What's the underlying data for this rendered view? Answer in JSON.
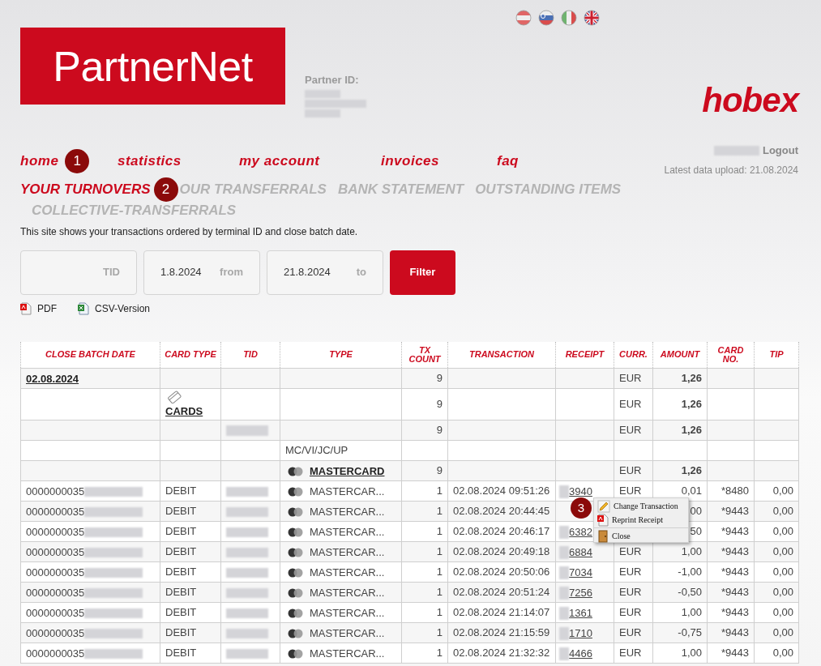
{
  "header": {
    "logo": "PartnerNet",
    "partner_id_label": "Partner ID:",
    "brand": "hobex",
    "logout": "Logout",
    "latest_upload": "Latest data upload: 21.08.2024"
  },
  "nav": [
    {
      "label": "home",
      "badge": "1"
    },
    {
      "label": "statistics"
    },
    {
      "label": "my account"
    },
    {
      "label": "invoices"
    },
    {
      "label": "faq"
    }
  ],
  "tabs": [
    {
      "label": "YOUR TURNOVERS",
      "selected": true,
      "badge": "2"
    },
    {
      "label": "OUR TRANSFERRALS",
      "selected": false
    },
    {
      "label": "BANK STATEMENT",
      "selected": false
    },
    {
      "label": "OUTSTANDING ITEMS",
      "selected": false
    },
    {
      "label": "COLLECTIVE-TRANSFERRALS",
      "selected": false
    }
  ],
  "intro": "This site shows your transactions ordered by terminal ID and close batch date.",
  "filter": {
    "fields": [
      {
        "label": "TID"
      },
      {
        "value": "1.8.2024",
        "label": "from"
      },
      {
        "value": "21.8.2024",
        "label": "to"
      }
    ],
    "button": "Filter"
  },
  "exports": [
    {
      "label": "PDF",
      "kind": "pdf"
    },
    {
      "label": "CSV-Version",
      "kind": "csv"
    }
  ],
  "table": {
    "columns": [
      "CLOSE BATCH DATE",
      "CARD TYPE",
      "TID",
      "TYPE",
      "TX COUNT",
      "TRANSACTION",
      "RECEIPT",
      "CURR.",
      "AMOUNT",
      "CARD NO.",
      "TIP"
    ],
    "rows": [
      {
        "kind": "batch",
        "date": "02.08.2024",
        "count": "9",
        "currency": "EUR",
        "amount": "1,26"
      },
      {
        "kind": "cards",
        "card_type": "CARDS",
        "count": "9",
        "currency": "EUR",
        "amount": "1,26"
      },
      {
        "kind": "terminal",
        "count": "9",
        "currency": "EUR",
        "amount": "1,26"
      },
      {
        "kind": "group",
        "type": "MC/VI/JC/UP"
      },
      {
        "kind": "brand",
        "type": "MASTERCARD",
        "count": "9",
        "currency": "EUR",
        "amount": "1,26"
      },
      {
        "kind": "tx",
        "batch": "0000000035",
        "card_type": "DEBIT",
        "type": "MASTERCAR...",
        "count": "1",
        "transaction": "02.08.2024 09:51:26",
        "receipt": "3940",
        "currency": "EUR",
        "amount": "0,01",
        "card_no": "*8480",
        "tip": "0,00"
      },
      {
        "kind": "tx",
        "batch": "0000000035",
        "card_type": "DEBIT",
        "type": "MASTERCAR...",
        "count": "1",
        "transaction": "02.08.2024 20:44:45",
        "amount": "00",
        "card_no": "*9443",
        "tip": "0,00"
      },
      {
        "kind": "tx",
        "batch": "0000000035",
        "card_type": "DEBIT",
        "type": "MASTERCAR...",
        "count": "1",
        "transaction": "02.08.2024 20:46:17",
        "receipt": "6382",
        "amount": "50",
        "card_no": "*9443",
        "tip": "0,00"
      },
      {
        "kind": "tx",
        "batch": "0000000035",
        "card_type": "DEBIT",
        "type": "MASTERCAR...",
        "count": "1",
        "transaction": "02.08.2024 20:49:18",
        "receipt": "6884",
        "currency": "EUR",
        "amount": "1,00",
        "card_no": "*9443",
        "tip": "0,00"
      },
      {
        "kind": "tx",
        "batch": "0000000035",
        "card_type": "DEBIT",
        "type": "MASTERCAR...",
        "count": "1",
        "transaction": "02.08.2024 20:50:06",
        "receipt": "7034",
        "currency": "EUR",
        "amount": "-1,00",
        "card_no": "*9443",
        "tip": "0,00"
      },
      {
        "kind": "tx",
        "batch": "0000000035",
        "card_type": "DEBIT",
        "type": "MASTERCAR...",
        "count": "1",
        "transaction": "02.08.2024 20:51:24",
        "receipt": "7256",
        "currency": "EUR",
        "amount": "-0,50",
        "card_no": "*9443",
        "tip": "0,00"
      },
      {
        "kind": "tx",
        "batch": "0000000035",
        "card_type": "DEBIT",
        "type": "MASTERCAR...",
        "count": "1",
        "transaction": "02.08.2024 21:14:07",
        "receipt": "1361",
        "currency": "EUR",
        "amount": "1,00",
        "card_no": "*9443",
        "tip": "0,00"
      },
      {
        "kind": "tx",
        "batch": "0000000035",
        "card_type": "DEBIT",
        "type": "MASTERCAR...",
        "count": "1",
        "transaction": "02.08.2024 21:15:59",
        "receipt": "1710",
        "currency": "EUR",
        "amount": "-0,75",
        "card_no": "*9443",
        "tip": "0,00"
      },
      {
        "kind": "tx",
        "batch": "0000000035",
        "card_type": "DEBIT",
        "type": "MASTERCAR...",
        "count": "1",
        "transaction": "02.08.2024 21:32:32",
        "receipt": "4466",
        "currency": "EUR",
        "amount": "1,00",
        "card_no": "*9443",
        "tip": "0,00"
      }
    ]
  },
  "context_menu": {
    "badge": "3",
    "items": [
      {
        "label": "Change Transaction",
        "kind": "edit"
      },
      {
        "label": "Reprint Receipt",
        "kind": "pdf"
      },
      {
        "label": "Close",
        "kind": "close"
      }
    ]
  }
}
